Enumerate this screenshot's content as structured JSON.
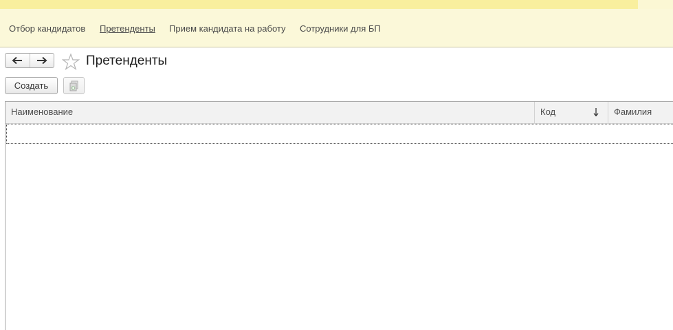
{
  "sections": {
    "items": [
      {
        "label": "Отбор кандидатов",
        "active": false
      },
      {
        "label": "Претенденты",
        "active": true
      },
      {
        "label": "Прием кандидата на работу",
        "active": false
      },
      {
        "label": "Сотрудники для БП",
        "active": false
      }
    ]
  },
  "navigation": {
    "back_icon": "arrow-left-icon",
    "forward_icon": "arrow-right-icon",
    "favorite_icon": "star-icon"
  },
  "page": {
    "title": "Претенденты"
  },
  "toolbar": {
    "create_label": "Создать",
    "copy_icon": "copy-document-icon"
  },
  "table": {
    "columns": [
      {
        "label": "Наименование"
      },
      {
        "label": "Код",
        "sort": "descending"
      },
      {
        "label": "Фамилия"
      }
    ],
    "rows": []
  },
  "colors": {
    "top_strip": "#f9ef9e",
    "section_panel": "#fbf8d9",
    "header_bg": "#f2f2f2"
  }
}
